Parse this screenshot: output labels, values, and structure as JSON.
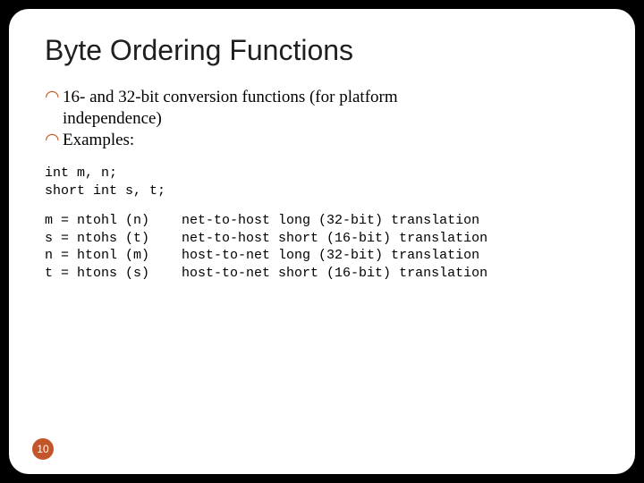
{
  "title": "Byte Ordering Functions",
  "bullets": [
    {
      "first": "16- and 32-bit conversion functions (for platform",
      "cont": "independence)"
    },
    {
      "first": "Examples:",
      "cont": ""
    }
  ],
  "code": {
    "decl": "int m, n;\nshort int s, t;",
    "lines": "m = ntohl (n)    net-to-host long (32-bit) translation\ns = ntohs (t)    net-to-host short (16-bit) translation\nn = htonl (m)    host-to-net long (32-bit) translation\nt = htons (s)    host-to-net short (16-bit) translation"
  },
  "page": "10"
}
